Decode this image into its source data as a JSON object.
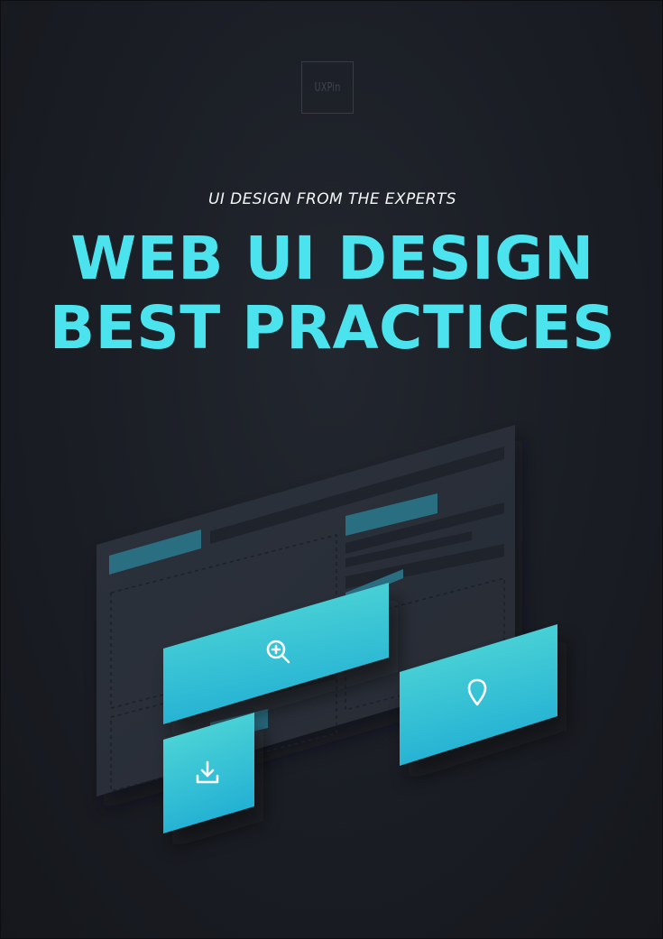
{
  "logo": {
    "text": "UXPin"
  },
  "cover": {
    "kicker": "UI DESIGN FROM THE EXPERTS",
    "title_line1": "WEB UI DESIGN",
    "title_line2": "BEST PRACTICES"
  },
  "illustration": {
    "tiles": [
      {
        "icon": "zoom-in-icon"
      },
      {
        "icon": "location-pin-icon"
      },
      {
        "icon": "download-icon"
      }
    ]
  },
  "colors": {
    "background": "#1a1d24",
    "accent": "#4ae3ee",
    "tile_light": "#4fd6d8",
    "tile_dark": "#27b3d2",
    "panel": "#2b313b",
    "panel_bar": "#1f242c",
    "panel_accent": "#2a6e82",
    "subtitle": "#f3f5f7"
  }
}
